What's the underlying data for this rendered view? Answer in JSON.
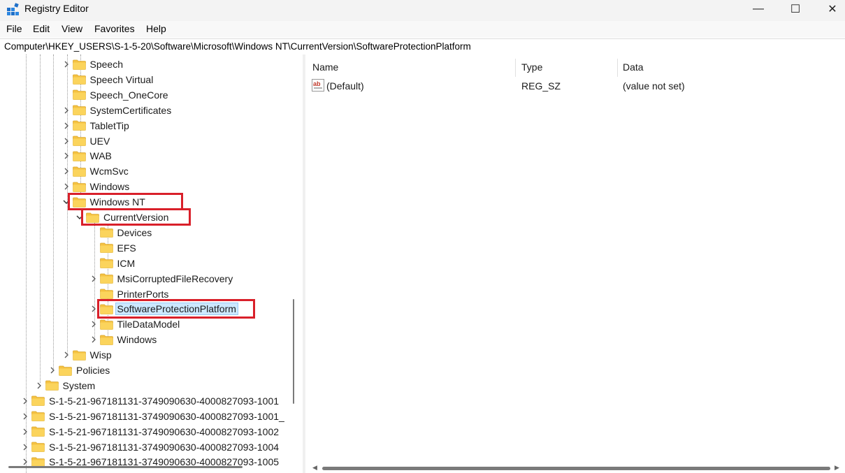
{
  "window": {
    "title": "Registry Editor",
    "controls": {
      "minimize": "—",
      "maximize": "☐",
      "close": "✕"
    }
  },
  "menu": [
    "File",
    "Edit",
    "View",
    "Favorites",
    "Help"
  ],
  "address": "Computer\\HKEY_USERS\\S-1-5-20\\Software\\Microsoft\\Windows NT\\CurrentVersion\\SoftwareProtectionPlatform",
  "tree": [
    {
      "label": "Speech",
      "level": 4,
      "expander": "collapsed"
    },
    {
      "label": "Speech Virtual",
      "level": 4,
      "expander": "none"
    },
    {
      "label": "Speech_OneCore",
      "level": 4,
      "expander": "none"
    },
    {
      "label": "SystemCertificates",
      "level": 4,
      "expander": "collapsed"
    },
    {
      "label": "TabletTip",
      "level": 4,
      "expander": "collapsed"
    },
    {
      "label": "UEV",
      "level": 4,
      "expander": "collapsed"
    },
    {
      "label": "WAB",
      "level": 4,
      "expander": "collapsed"
    },
    {
      "label": "WcmSvc",
      "level": 4,
      "expander": "collapsed"
    },
    {
      "label": "Windows",
      "level": 4,
      "expander": "collapsed"
    },
    {
      "label": "Windows NT",
      "level": 4,
      "expander": "expanded",
      "highlighted": true
    },
    {
      "label": "CurrentVersion",
      "level": 5,
      "expander": "expanded",
      "highlighted": true
    },
    {
      "label": "Devices",
      "level": 6,
      "expander": "none"
    },
    {
      "label": "EFS",
      "level": 6,
      "expander": "none"
    },
    {
      "label": "ICM",
      "level": 6,
      "expander": "none"
    },
    {
      "label": "MsiCorruptedFileRecovery",
      "level": 6,
      "expander": "collapsed"
    },
    {
      "label": "PrinterPorts",
      "level": 6,
      "expander": "none"
    },
    {
      "label": "SoftwareProtectionPlatform",
      "level": 6,
      "expander": "collapsed",
      "selected": true,
      "highlighted": true
    },
    {
      "label": "TileDataModel",
      "level": 6,
      "expander": "collapsed"
    },
    {
      "label": "Windows",
      "level": 6,
      "expander": "collapsed"
    },
    {
      "label": "Wisp",
      "level": 4,
      "expander": "collapsed"
    },
    {
      "label": "Policies",
      "level": 3,
      "expander": "collapsed"
    },
    {
      "label": "System",
      "level": 2,
      "expander": "collapsed"
    },
    {
      "label": "S-1-5-21-967181131-3749090630-4000827093-1001",
      "level": 1,
      "expander": "collapsed"
    },
    {
      "label": "S-1-5-21-967181131-3749090630-4000827093-1001_",
      "level": 1,
      "expander": "collapsed"
    },
    {
      "label": "S-1-5-21-967181131-3749090630-4000827093-1002",
      "level": 1,
      "expander": "collapsed"
    },
    {
      "label": "S-1-5-21-967181131-3749090630-4000827093-1004",
      "level": 1,
      "expander": "collapsed"
    },
    {
      "label": "S-1-5-21-967181131-3749090630-4000827093-1005",
      "level": 1,
      "expander": "collapsed"
    }
  ],
  "list": {
    "columns": [
      "Name",
      "Type",
      "Data"
    ],
    "rows": [
      {
        "name": "(Default)",
        "type": "REG_SZ",
        "data": "(value not set)",
        "icon": "string-value-icon"
      }
    ]
  },
  "colors": {
    "highlight_box": "#d9202a",
    "folder": "#f5c242",
    "selection": "#cce8ff"
  }
}
